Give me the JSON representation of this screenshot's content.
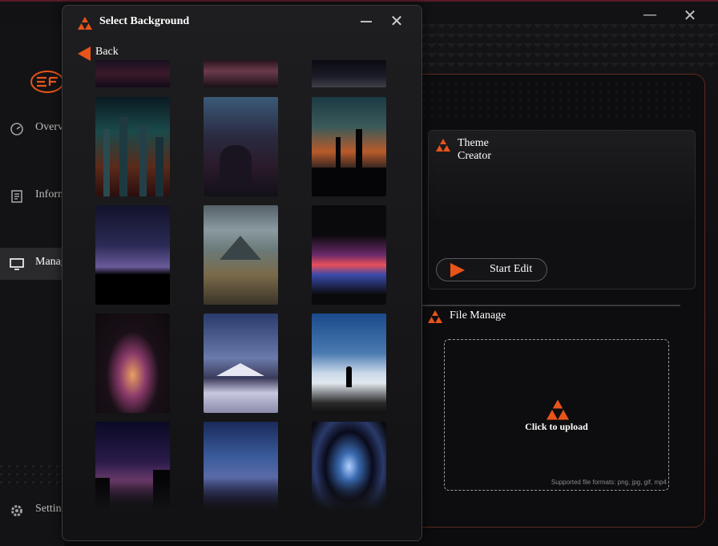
{
  "app": {
    "colors": {
      "accent": "#e8541a",
      "bg": "#0b0b0d",
      "panel_border": "#5b2a1e"
    },
    "window_buttons": {
      "minimize": "—",
      "close": "✕"
    },
    "sidebar": {
      "items": [
        {
          "label": "Overview",
          "icon": "gauge-icon"
        },
        {
          "label": "Information",
          "icon": "document-icon"
        },
        {
          "label": "Manage",
          "icon": "monitor-icon"
        }
      ],
      "settings": {
        "label": "Settings",
        "icon": "gear-icon"
      }
    },
    "theme_creator": {
      "title_line1": "Theme",
      "title_line2": "Creator",
      "start_label": "Start Edit"
    },
    "file_manage": {
      "title": "File Manage",
      "upload_label": "Click to upload",
      "formats": "Supported file formats: png, jpg, gif, mp4"
    }
  },
  "dialog": {
    "title": "Select Background",
    "back_label": "Back",
    "close_glyph": "✕",
    "thumbnails": [
      {
        "name": "partial-robot"
      },
      {
        "name": "partial-neon-room"
      },
      {
        "name": "partial-car-street"
      },
      {
        "name": "neon-city"
      },
      {
        "name": "cyberpunk-girl-window"
      },
      {
        "name": "sunset-city-skyline"
      },
      {
        "name": "starry-forest-night"
      },
      {
        "name": "misty-mountain-lake"
      },
      {
        "name": "abstract-light-waves"
      },
      {
        "name": "glowing-fluid-swirl"
      },
      {
        "name": "snowy-volcano-dusk"
      },
      {
        "name": "person-above-clouds"
      },
      {
        "name": "milky-way-forest"
      },
      {
        "name": "moon-mountain-valley"
      },
      {
        "name": "blue-vortex-ring"
      }
    ]
  }
}
